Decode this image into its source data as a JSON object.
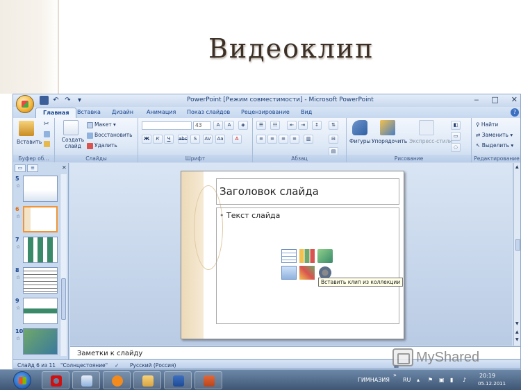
{
  "page": {
    "title": "Видеоклип"
  },
  "window": {
    "title": "PowerPoint [Режим совместимости] - Microsoft PowerPoint",
    "controls": [
      "‒",
      "□",
      "✕"
    ]
  },
  "ribbon": {
    "tabs": [
      "Главная",
      "Вставка",
      "Дизайн",
      "Анимация",
      "Показ слайдов",
      "Рецензирование",
      "Вид"
    ],
    "groups": {
      "clipboard": {
        "label": "Буфер об...",
        "paste": "Вставить"
      },
      "slides": {
        "label": "Слайды",
        "create_slide": "Создать слайд",
        "layout": "Макет",
        "reset": "Восстановить",
        "delete": "Удалить"
      },
      "font": {
        "label": "Шрифт",
        "font_size": "43"
      },
      "paragraph": {
        "label": "Абзац"
      },
      "drawing": {
        "label": "Рисование",
        "shapes": "Фигуры",
        "arrange": "Упорядочить",
        "quick_styles": "Экспресс-стили"
      },
      "editing": {
        "label": "Редактирование",
        "find": "Найти",
        "replace": "Заменить",
        "select": "Выделить"
      }
    }
  },
  "slides_panel": {
    "thumbnails": [
      {
        "num": "5"
      },
      {
        "num": "6"
      },
      {
        "num": "7"
      },
      {
        "num": "8"
      },
      {
        "num": "9"
      },
      {
        "num": "10"
      }
    ],
    "selected": "6"
  },
  "slide": {
    "title_placeholder": "Заголовок слайда",
    "body_placeholder": "Текст слайда",
    "tooltip": "Вставить клип из коллекции"
  },
  "notes": {
    "placeholder": "Заметки к слайду"
  },
  "status": {
    "slide_counter": "Слайд 6 из 11",
    "theme": "\"Солнцестояние\"",
    "language": "Русский (Россия)"
  },
  "watermark": {
    "text": "MyShared"
  },
  "taskbar": {
    "school_label": "ГИМНАЗИЯ",
    "lang": "RU",
    "time": "20:19",
    "date": "05.12.2011"
  }
}
